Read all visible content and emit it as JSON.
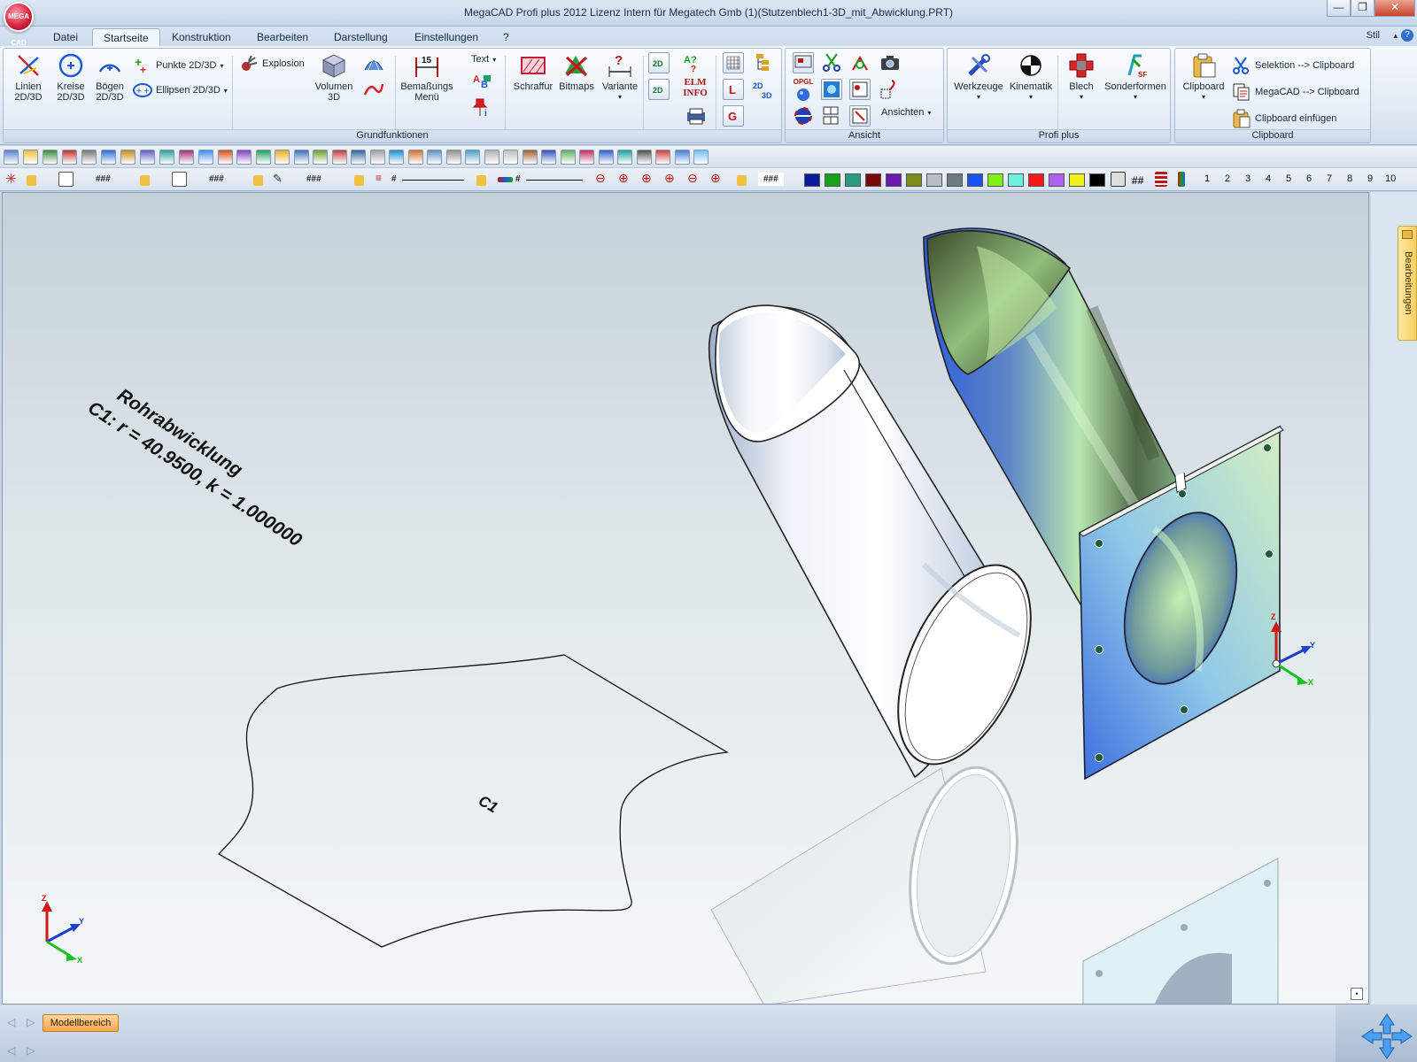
{
  "window": {
    "title": "MegaCAD Profi plus 2012  Lizenz Intern für Megatech Gmb (1)(Stutzenblech1-3D_mit_Abwicklung.PRT)",
    "logo_text": "MEGA CAD",
    "buttons": {
      "minimize": "—",
      "maximize": "❐",
      "close": "✕"
    }
  },
  "menu": {
    "tabs": [
      "Datei",
      "Startseite",
      "Konstruktion",
      "Bearbeiten",
      "Darstellung",
      "Einstellungen",
      "?"
    ],
    "active": "Startseite",
    "style_label": "Stil"
  },
  "ribbon": {
    "grundfunktionen": {
      "label": "Grundfunktionen",
      "linien": [
        "Linien",
        "2D/3D"
      ],
      "kreise": [
        "Kreise",
        "2D/3D"
      ],
      "boegen": [
        "Bögen",
        "2D/3D"
      ],
      "punkte": "Punkte 2D/3D",
      "ellipsen": "Ellipsen 2D/3D",
      "explosion": "Explosion",
      "volumen": [
        "Volumen",
        "3D"
      ],
      "bemassung": [
        "Bemaßungs",
        "Menü"
      ],
      "bemassung_value": "15",
      "text": "Text",
      "schraffur": "Schraffur",
      "bitmaps": "Bitmaps",
      "variante": "Variante",
      "elm_info": [
        "ELM",
        "INFO"
      ]
    },
    "ansicht": {
      "label": "Ansicht",
      "ansichten": "Ansichten",
      "opgl": "OPGL"
    },
    "profi_plus": {
      "label": "Profi plus",
      "werkzeuge": "Werkzeuge",
      "kinematik": "Kinematik",
      "blech": "Blech",
      "sonderformen": "Sonderformen"
    },
    "clipboard": {
      "label": "Clipboard",
      "clipboard": "Clipboard",
      "selektion": "Selektion --> Clipboard",
      "megacad": "MegaCAD --> Clipboard",
      "einfuegen": "Clipboard einfügen"
    }
  },
  "toolbar2": {
    "placeholders": [
      "###",
      "###",
      "###",
      "###"
    ],
    "hash_marks": [
      "#",
      "#",
      "##"
    ],
    "colors": [
      "#0a1b9e",
      "#18a01c",
      "#2a9b7e",
      "#7a0a0a",
      "#6a1ab0",
      "#7e8a1c",
      "#b8bfc4",
      "#6f7a80",
      "#1a54f0",
      "#80f01a",
      "#70f0e0",
      "#f01a1a",
      "#b060f0",
      "#f0f01a",
      "#000000"
    ],
    "layers": [
      "1",
      "2",
      "3",
      "4",
      "5",
      "6",
      "7",
      "8",
      "9",
      "10"
    ]
  },
  "canvas": {
    "annotation_title": "Rohrabwicklung",
    "annotation_formula": "C1: r = 40.9500, k = 1.000000",
    "contour_label": "C1",
    "axes": {
      "x": "X",
      "y": "Y",
      "z": "Z"
    }
  },
  "side_panel": {
    "tab_label": "Bearbeitungen"
  },
  "bottom": {
    "model_tab": "Modellbereich"
  }
}
